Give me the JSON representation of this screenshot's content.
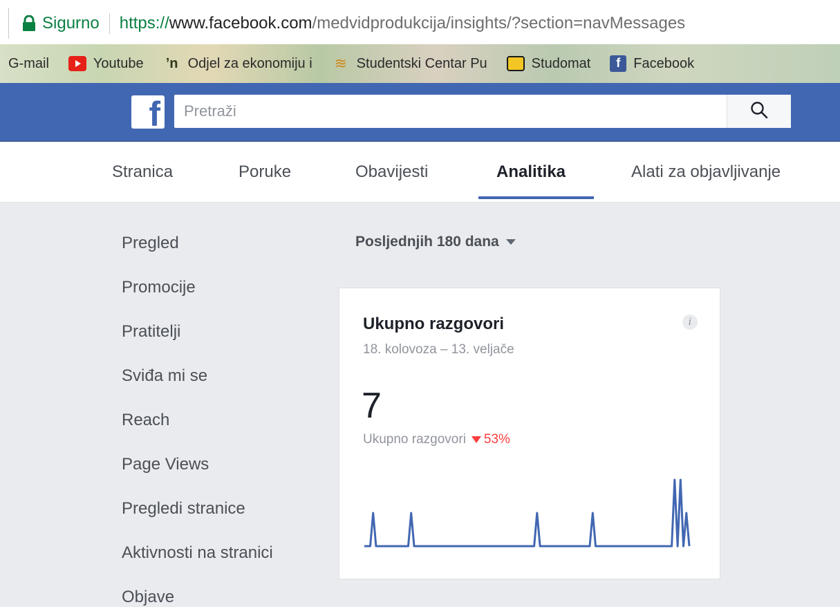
{
  "browser": {
    "secure_label": "Sigurno",
    "url_scheme": "https://",
    "url_host": "www.facebook.com",
    "url_path": "/medvidprodukcija/insights/?section=navMessages"
  },
  "bookmarks": [
    {
      "label": "G-mail",
      "icon": "none"
    },
    {
      "label": "Youtube",
      "icon": "youtube-icon"
    },
    {
      "label": "Odjel za ekonomiju i",
      "icon": "odjel-icon"
    },
    {
      "label": "Studentski Centar Pu",
      "icon": "studentski-centar-icon"
    },
    {
      "label": "Studomat",
      "icon": "studomat-icon"
    },
    {
      "label": "Facebook",
      "icon": "facebook-icon"
    }
  ],
  "header": {
    "logo": "f",
    "search_placeholder": "Pretraži"
  },
  "tabs": [
    {
      "label": "Stranica"
    },
    {
      "label": "Poruke"
    },
    {
      "label": "Obavijesti"
    },
    {
      "label": "Analitika",
      "active": true
    },
    {
      "label": "Alati za objavljivanje"
    }
  ],
  "sidebar": {
    "items": [
      {
        "label": "Pregled"
      },
      {
        "label": "Promocije"
      },
      {
        "label": "Pratitelji"
      },
      {
        "label": "Sviđa mi se"
      },
      {
        "label": "Reach"
      },
      {
        "label": "Page Views"
      },
      {
        "label": "Pregledi stranice"
      },
      {
        "label": "Aktivnosti na stranici"
      },
      {
        "label": "Objave"
      }
    ]
  },
  "period": {
    "label": "Posljednjih 180 dana"
  },
  "card": {
    "title": "Ukupno razgovori",
    "date_range": "18. kolovoza – 13. veljače",
    "value": "7",
    "comparison_label": "Ukupno razgovori",
    "change": "53%",
    "change_color": "#fa3e3e",
    "line_color": "#4267b2",
    "trend": [
      0,
      0,
      0,
      1,
      0,
      0,
      0,
      0,
      0,
      0,
      0,
      0,
      0,
      0,
      0,
      0,
      1,
      0,
      0,
      0,
      0,
      0,
      0,
      0,
      0,
      0,
      0,
      0,
      0,
      0,
      0,
      0,
      0,
      0,
      0,
      0,
      0,
      0,
      0,
      0,
      0,
      0,
      0,
      0,
      0,
      0,
      0,
      0,
      0,
      0,
      0,
      0,
      0,
      0,
      0,
      0,
      0,
      0,
      0,
      1,
      0,
      0,
      0,
      0,
      0,
      0,
      0,
      0,
      0,
      0,
      0,
      0,
      0,
      0,
      0,
      0,
      0,
      0,
      1,
      0,
      0,
      0,
      0,
      0,
      0,
      0,
      0,
      0,
      0,
      0,
      0,
      0,
      0,
      0,
      0,
      0,
      0,
      0,
      0,
      0,
      0,
      0,
      0,
      0,
      0,
      0,
      2,
      0,
      2,
      0,
      1,
      0
    ]
  }
}
